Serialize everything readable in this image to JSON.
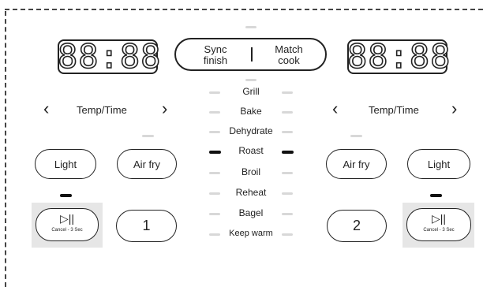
{
  "left": {
    "display": "88:88",
    "temp_time_label": "Temp/Time",
    "light_label": "Light",
    "air_fry_label": "Air fry",
    "oven_number": "1",
    "play_pause_glyph": "▷||",
    "cancel_label": "Cancel - 3 Sec"
  },
  "right": {
    "display": "88:88",
    "temp_time_label": "Temp/Time",
    "light_label": "Light",
    "air_fry_label": "Air fry",
    "oven_number": "2",
    "play_pause_glyph": "▷||",
    "cancel_label": "Cancel - 3 Sec"
  },
  "center": {
    "sync_label": "Sync\nfinish",
    "match_label": "Match\ncook",
    "modes": [
      "Grill",
      "Bake",
      "Dehydrate",
      "Roast",
      "Broil",
      "Reheat",
      "Bagel",
      "Keep warm"
    ],
    "active_mode": "Roast"
  },
  "icons": {
    "left_arrow": "chevron-left-icon",
    "right_arrow": "chevron-right-icon",
    "play_pause": "play-pause-icon"
  },
  "colors": {
    "indicator_on": "#111111",
    "indicator_off": "#d8d8d8",
    "highlight_bg": "#e6e6e6"
  }
}
